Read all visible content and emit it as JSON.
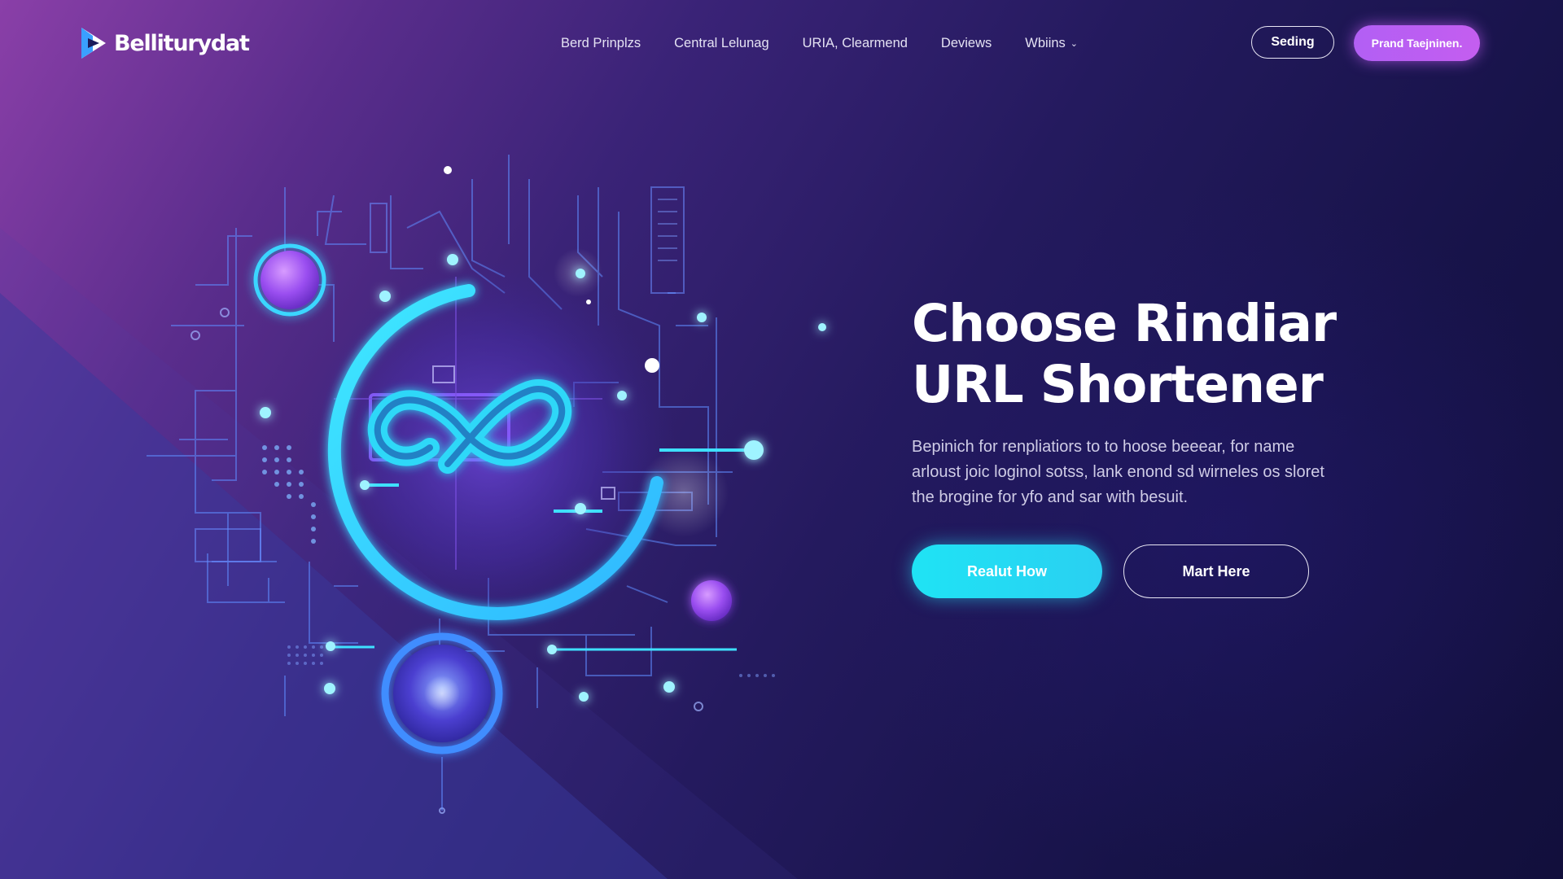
{
  "brand": {
    "name": "Belliturydat",
    "logo_icon": "play-triangle-logo-icon"
  },
  "nav": {
    "links": [
      {
        "label": "Berd Prinplzs"
      },
      {
        "label": "Central Lelunag"
      },
      {
        "label": "URIA, Clearmend"
      },
      {
        "label": "Deviews"
      },
      {
        "label": "Wbiins",
        "icon": "chevron-down-icon"
      }
    ],
    "secondary_button": "Seding",
    "primary_button": "Prand Taejninen."
  },
  "hero": {
    "title_line1": "Choose Rindiar",
    "title_line2": "URL Shortener",
    "description": "Bepinich for renpliatiors to to hoose beeear, for name arloust joic loginol sotss, lank enond sd wirneles os sloret the brogine for yfo and sar with besuit.",
    "primary_cta": "Realut How",
    "secondary_cta": "Mart Here",
    "illustration_icon": "infinity-link-icon"
  },
  "colors": {
    "accent_cyan": "#1fe3f4",
    "accent_purple": "#b25ff4",
    "background_dark": "#171349",
    "background_purple": "#8a3fa8"
  }
}
